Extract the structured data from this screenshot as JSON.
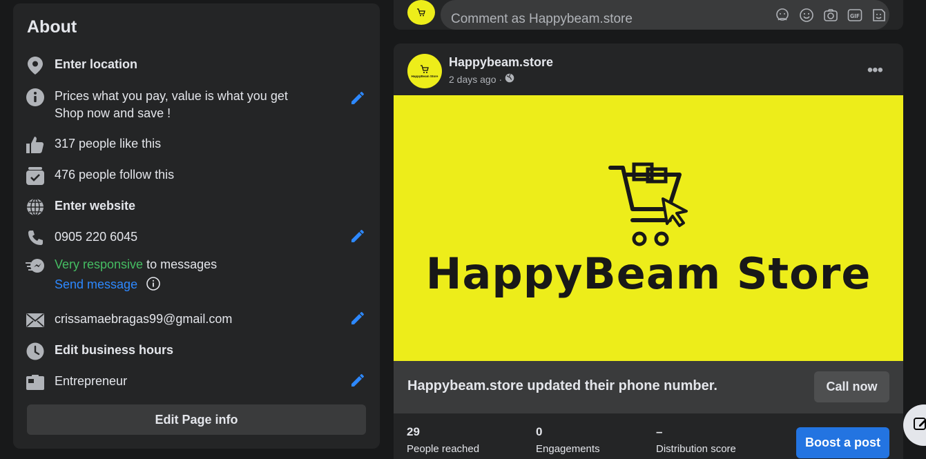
{
  "about": {
    "title": "About",
    "location": "Enter location",
    "bio_line1": "Prices what you pay, value is what you get",
    "bio_line2": "Shop now and save !",
    "likes": "317 people like this",
    "follows": "476 people follow this",
    "website": "Enter website",
    "phone": "0905 220 6045",
    "responsive": "Very responsive",
    "responsive_suffix": " to messages",
    "send_message": "Send message",
    "email": "crissamaebragas99@gmail.com",
    "business_hours": "Edit business hours",
    "category": "Entrepreneur",
    "edit_page_info": "Edit Page info"
  },
  "comment": {
    "placeholder": "Comment as Happybeam.store"
  },
  "post": {
    "author": "Happybeam.store",
    "time": "2 days ago",
    "separator": "·",
    "more": "•••",
    "image_brand": "HappyBeam Store",
    "avatar_text": "HappyBeam Store",
    "update_text": "Happybeam.store updated their phone number.",
    "call_now": "Call now",
    "stats": [
      {
        "value": "29",
        "label": "People reached"
      },
      {
        "value": "0",
        "label": "Engagements"
      },
      {
        "value": "–",
        "label": "Distribution score"
      }
    ],
    "boost": "Boost a post"
  },
  "colors": {
    "link": "#2d88ff",
    "green": "#45bd62",
    "brand_yellow": "#eded1a",
    "boost_blue": "#2374e1"
  },
  "icons": {
    "comment_tools": [
      "avatar-sticker-icon",
      "emoji-icon",
      "camera-icon",
      "gif-icon",
      "sticker-icon"
    ]
  }
}
